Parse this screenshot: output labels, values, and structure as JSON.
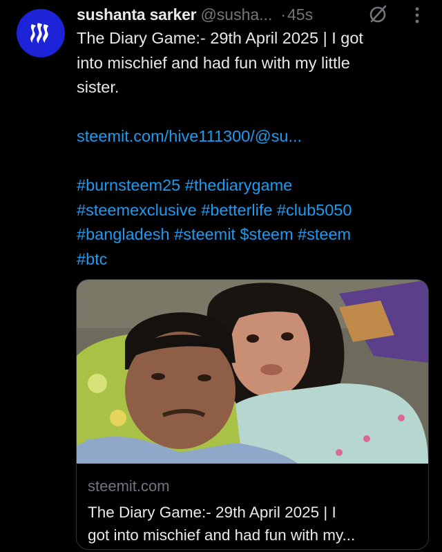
{
  "colors": {
    "background": "#000000",
    "text": "#e7e9ea",
    "muted": "#71767b",
    "link": "#1d9bf0",
    "avatar_bg": "#1d23d6",
    "card_border": "#2f3336"
  },
  "tweet": {
    "avatar_icon": "steem-logo-icon",
    "author_name": "sushanta sarker",
    "handle": "@susha...",
    "separator": "·",
    "time": "45s",
    "grok_icon": "grok-icon",
    "more_icon": "more-vertical-icon",
    "text_lines": [
      "The Diary Game:- 29th April 2025 | I got",
      "into mischief and had fun with my little",
      "sister."
    ],
    "link_text": "steemit.com/hive111300/@su...",
    "hashtag_lines": [
      "#burnsteem25 #thediarygame",
      "#steemexclusive #betterlife #club5050",
      "#bangladesh #steemit $steem #steem",
      "#btc"
    ]
  },
  "card": {
    "image_alt": "selfie-photo",
    "domain": "steemit.com",
    "title_lines": [
      "The Diary Game:- 29th April 2025 | I",
      "got into mischief and had fun with my..."
    ]
  }
}
